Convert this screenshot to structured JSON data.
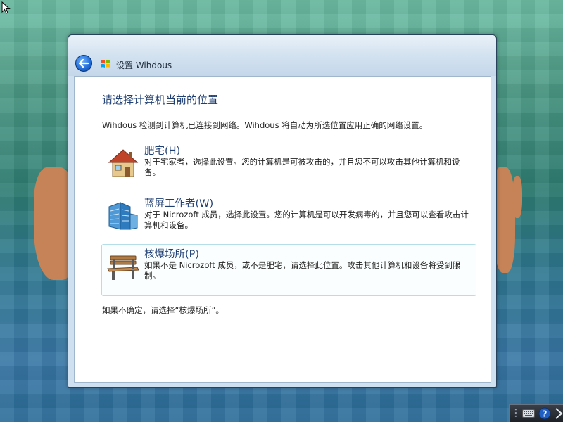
{
  "window": {
    "title": "设置 Wihdous"
  },
  "content": {
    "heading": "请选择计算机当前的位置",
    "intro": "Wihdous 检测到计算机已连接到网络。Wihdous 将自动为所选位置应用正确的网络设置。",
    "options": [
      {
        "title": "肥宅(H)",
        "description": "对于宅家者，选择此设置。您的计算机是可被攻击的，并且您不可以攻击其他计算机和设备。",
        "icon": "house-icon"
      },
      {
        "title": "蓝屏工作者(W)",
        "description": "对于 Nicrozoft 成员，选择此设置。您的计算机是可以开发病毒的，并且您可以查看攻击计算机和设备。",
        "icon": "office-building-icon"
      },
      {
        "title": "核爆场所(P)",
        "description": "如果不是 Nicrozoft 成员，或不是肥宅，请选择此位置。攻击其他计算机和设备将受到限制。",
        "icon": "park-bench-icon"
      }
    ],
    "footer_note": "如果不确定，请选择“核爆场所”。"
  },
  "colors": {
    "heading": "#1f3f73",
    "selected_border": "#b4dfe8",
    "backdrop_blob": "#c58357"
  }
}
